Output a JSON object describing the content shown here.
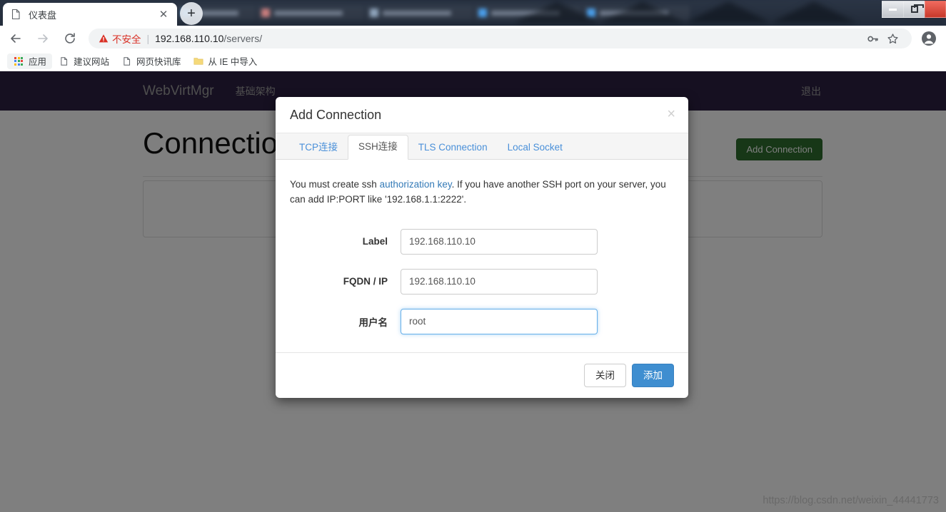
{
  "browser": {
    "tab": {
      "title": "仪表盘",
      "favicon_icon": "page-icon",
      "close_icon": "✕"
    },
    "new_tab_label": "+",
    "window_controls": {
      "minimize": "minimize-icon",
      "maximize": "restore-icon",
      "close": "close-icon"
    },
    "nav": {
      "back_icon": "arrow-left-icon",
      "forward_icon": "arrow-right-icon",
      "reload_icon": "reload-icon"
    },
    "omnibox": {
      "warning_icon": "warning-triangle-icon",
      "warning_text": "不安全",
      "separator": "|",
      "url_host": "192.168.110.10",
      "url_path": "/servers/",
      "key_icon": "key-icon",
      "star_icon": "star-icon",
      "profile_icon": "profile-avatar-icon"
    },
    "bookmarks": [
      {
        "label": "应用",
        "icon": "apps-grid-icon"
      },
      {
        "label": "建议网站",
        "icon": "page-icon"
      },
      {
        "label": "网页快讯库",
        "icon": "page-icon"
      },
      {
        "label": "从 IE 中导入",
        "icon": "folder-icon"
      }
    ]
  },
  "site": {
    "navbar": {
      "brand": "WebVirtMgr",
      "links": [
        {
          "label": "基础架构"
        }
      ],
      "logout_label": "退出",
      "background_color": "#2d2142"
    },
    "page_title": "Connections",
    "add_connection_button": "Add Connection",
    "add_connection_color": "#2f6f2f",
    "watermark": "https://blog.csdn.net/weixin_44441773"
  },
  "modal": {
    "title": "Add Connection",
    "close_icon": "×",
    "tabs": [
      {
        "label": "TCP连接",
        "active": false
      },
      {
        "label": "SSH连接",
        "active": true
      },
      {
        "label": "TLS Connection",
        "active": false
      },
      {
        "label": "Local Socket",
        "active": false
      }
    ],
    "hint": {
      "before_link": "You must create ssh ",
      "link_text": "authorization key",
      "after_link": ". If you have another SSH port on your server, you can add IP:PORT like '192.168.1.1:2222'.",
      "link_color": "#337ab7"
    },
    "fields": [
      {
        "label": "Label",
        "value": "192.168.110.10",
        "placeholder": "Label",
        "focused": false
      },
      {
        "label": "FQDN / IP",
        "value": "192.168.110.10",
        "placeholder": "FQDN / IP",
        "focused": false
      },
      {
        "label": "用户名",
        "value": "root",
        "placeholder": "用户名",
        "focused": true
      }
    ],
    "footer": {
      "close_label": "关闭",
      "submit_label": "添加",
      "submit_color": "#3f8ed0"
    }
  }
}
